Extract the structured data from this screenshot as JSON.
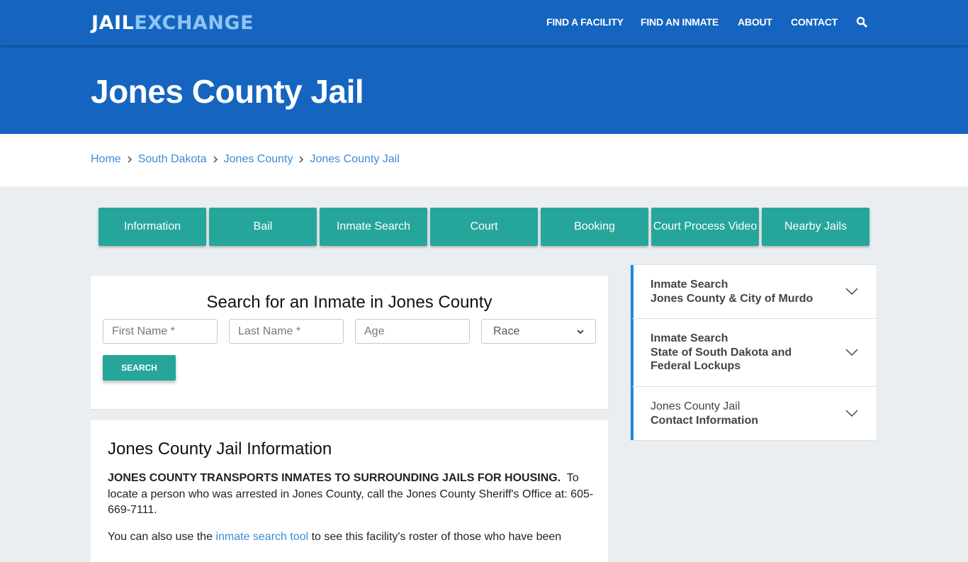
{
  "header": {
    "logo_part1": "JAIL",
    "logo_part2": "EXCHANGE",
    "nav": [
      {
        "label": "FIND A FACILITY"
      },
      {
        "label": "FIND AN INMATE"
      },
      {
        "label": "ABOUT"
      },
      {
        "label": "CONTACT"
      }
    ],
    "search_icon": "search-icon"
  },
  "hero": {
    "title": "Jones County Jail"
  },
  "breadcrumb": [
    {
      "label": "Home"
    },
    {
      "label": "South Dakota"
    },
    {
      "label": "Jones County"
    },
    {
      "label": "Jones County Jail"
    }
  ],
  "tabs": [
    {
      "label": "Information"
    },
    {
      "label": "Bail"
    },
    {
      "label": "Inmate Search"
    },
    {
      "label": "Court"
    },
    {
      "label": "Booking"
    },
    {
      "label": "Court Process Video"
    },
    {
      "label": "Nearby Jails"
    }
  ],
  "search_form": {
    "title": "Search for an Inmate in Jones County",
    "first_name_placeholder": "First Name *",
    "last_name_placeholder": "Last Name *",
    "age_placeholder": "Age",
    "race_selected": "Race",
    "submit_label": "SEARCH"
  },
  "info": {
    "title": "Jones County Jail Information",
    "p1_bold": "JONES COUNTY TRANSPORTS INMATES TO SURROUNDING JAILS FOR HOUSING.",
    "p1_rest": "  To locate a person who was arrested in Jones County, call the Jones County Sheriff's Office at: 605-669-7111.",
    "p2_before": "You can also use the ",
    "p2_link": "inmate search tool",
    "p2_after": " to see this facility's roster of those who have been"
  },
  "sidebar": {
    "items": [
      {
        "line1": "Inmate Search",
        "line2": "Jones County & City of Murdo"
      },
      {
        "line1": "Inmate Search",
        "line2": "State of South Dakota and Federal Lockups"
      },
      {
        "line1": "Jones County Jail",
        "line2": "Contact Information"
      }
    ]
  },
  "colors": {
    "brand_blue": "#1565c0",
    "logo_accent": "#8fc5f4",
    "teal": "#26a69a",
    "link": "#3d8bd8",
    "accordion_accent": "#1e88e5"
  }
}
